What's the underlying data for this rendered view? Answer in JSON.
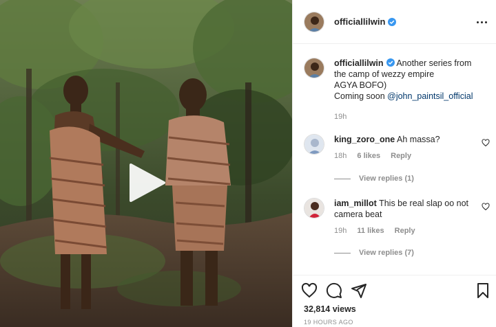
{
  "post": {
    "author": {
      "username": "officiallilwin",
      "verified": true,
      "avatar": "avatar-photo"
    },
    "caption": {
      "username": "officiallilwin",
      "line1": "Another series from",
      "line2": "the camp of wezzy empire",
      "line3": "AGYA BOFO)",
      "line4_prefix": "Coming soon ",
      "mention": "@john_paintsil_official",
      "time": "19h"
    },
    "comments": [
      {
        "username": "king_zoro_one",
        "text": "Ah massa?",
        "time": "18h",
        "likes": "6 likes",
        "reply": "Reply",
        "view_replies": "View replies (1)"
      },
      {
        "username": "iam_millot",
        "text": "This be real slap oo not camera beat",
        "time": "19h",
        "likes": "11 likes",
        "reply": "Reply",
        "view_replies": "View replies (7)"
      }
    ],
    "stats": {
      "views": "32,814 views",
      "time_ago": "19 HOURS AGO"
    },
    "icons": {
      "like": "heart-icon",
      "comment": "comment-icon",
      "share": "share-icon",
      "save": "bookmark-icon",
      "more": "more-icon",
      "play": "play-icon"
    },
    "colors": {
      "verified": "#3897f0",
      "mention": "#00376b",
      "muted": "#8e8e8e",
      "text": "#262626"
    }
  }
}
